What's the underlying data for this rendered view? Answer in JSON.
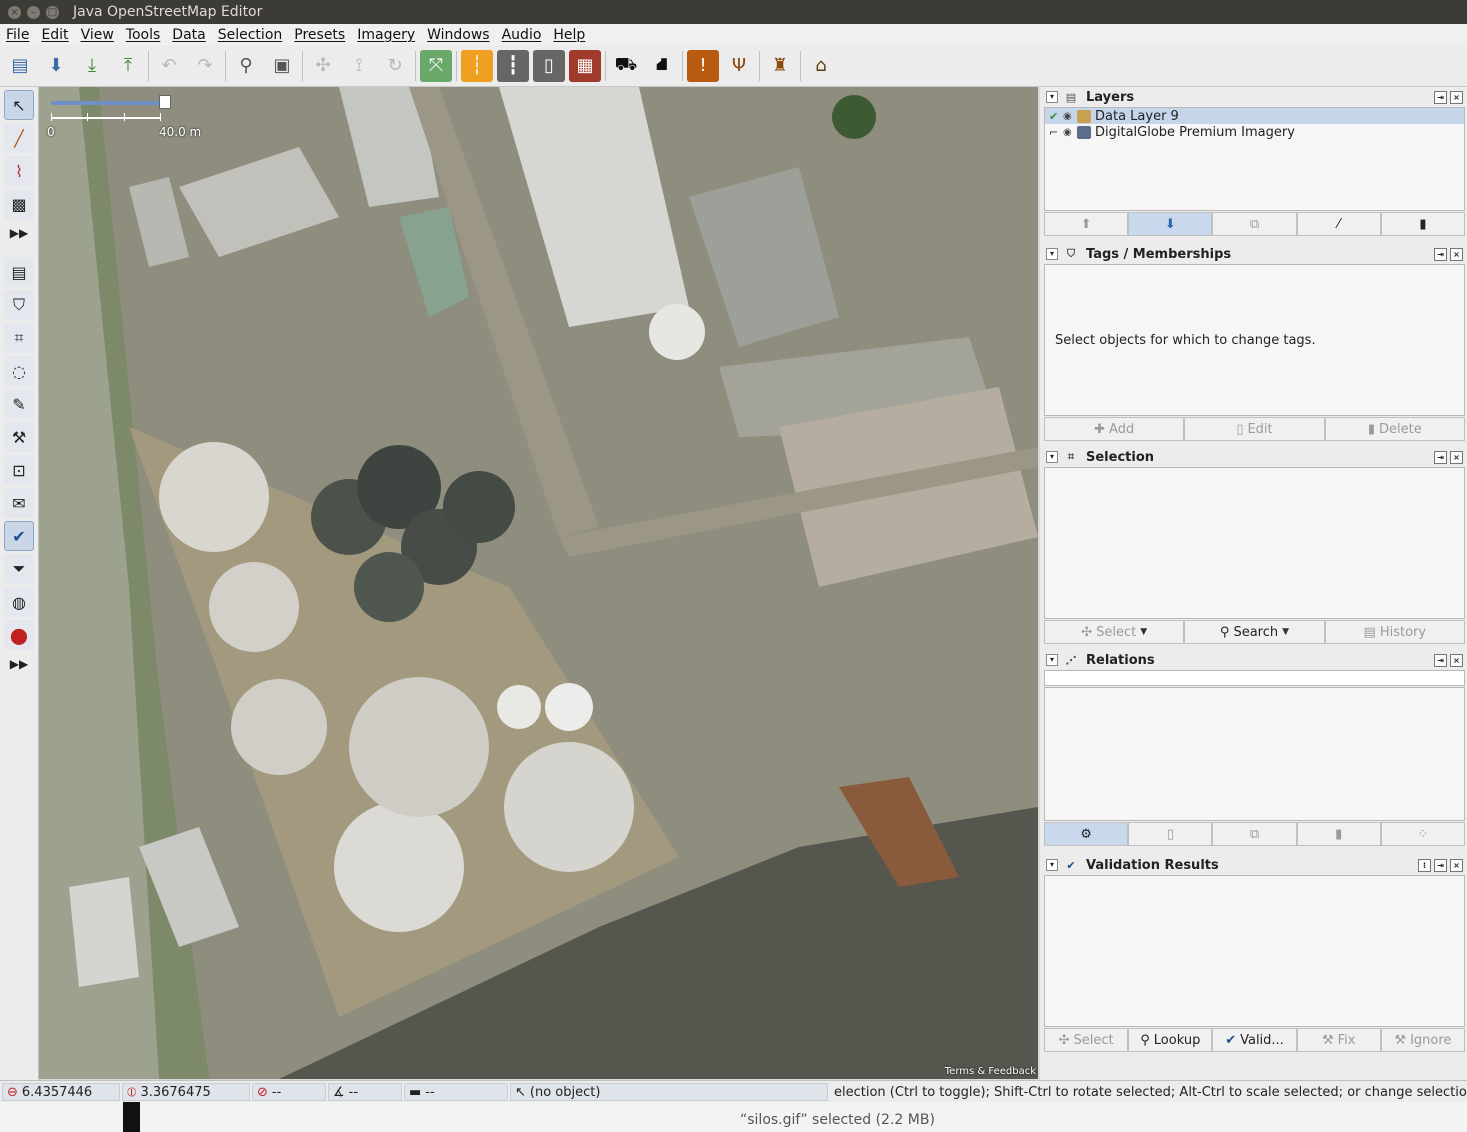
{
  "window": {
    "title": "Java OpenStreetMap Editor"
  },
  "menu": [
    "File",
    "Edit",
    "View",
    "Tools",
    "Data",
    "Selection",
    "Presets",
    "Imagery",
    "Windows",
    "Audio",
    "Help"
  ],
  "toolbar": {
    "icons": [
      "open-file-icon",
      "save-icon",
      "download-icon",
      "upload-icon",
      "undo-icon",
      "redo-icon",
      "preferences-icon",
      "zoom-icon",
      "simplify-icon",
      "split-icon",
      "refresh-icon",
      "wireframe-icon",
      "highway-icon",
      "railway-icon",
      "barrier-icon",
      "wall-icon",
      "car-icon",
      "bus-icon",
      "hazard-icon",
      "restaurant-icon",
      "castle-icon",
      "factory-icon"
    ]
  },
  "map": {
    "scale_start": "0",
    "scale_end": "40.0 m",
    "attribution": "Terms & Feedback"
  },
  "layers": {
    "title": "Layers",
    "items": [
      {
        "name": "Data Layer 9",
        "selected": true
      },
      {
        "name": "DigitalGlobe Premium Imagery",
        "selected": false
      }
    ]
  },
  "tags": {
    "title": "Tags / Memberships",
    "empty_text": "Select objects for which to change tags.",
    "buttons": [
      "Add",
      "Edit",
      "Delete"
    ]
  },
  "selection": {
    "title": "Selection",
    "buttons": [
      "Select",
      "Search",
      "History"
    ]
  },
  "relations": {
    "title": "Relations"
  },
  "validation": {
    "title": "Validation Results",
    "buttons": [
      "Select",
      "Lookup",
      "Valid...",
      "Fix",
      "Ignore"
    ]
  },
  "status": {
    "lat": "6.4357446",
    "lon": "3.3676475",
    "heading": "--",
    "angle": "--",
    "distance": "--",
    "object": "(no object)",
    "help": "election (Ctrl to toggle); Shift-Ctrl to rotate selected; Alt-Ctrl to scale selected; or change selection"
  },
  "desktop": {
    "message": "“silos.gif” selected  (2.2 MB)"
  }
}
